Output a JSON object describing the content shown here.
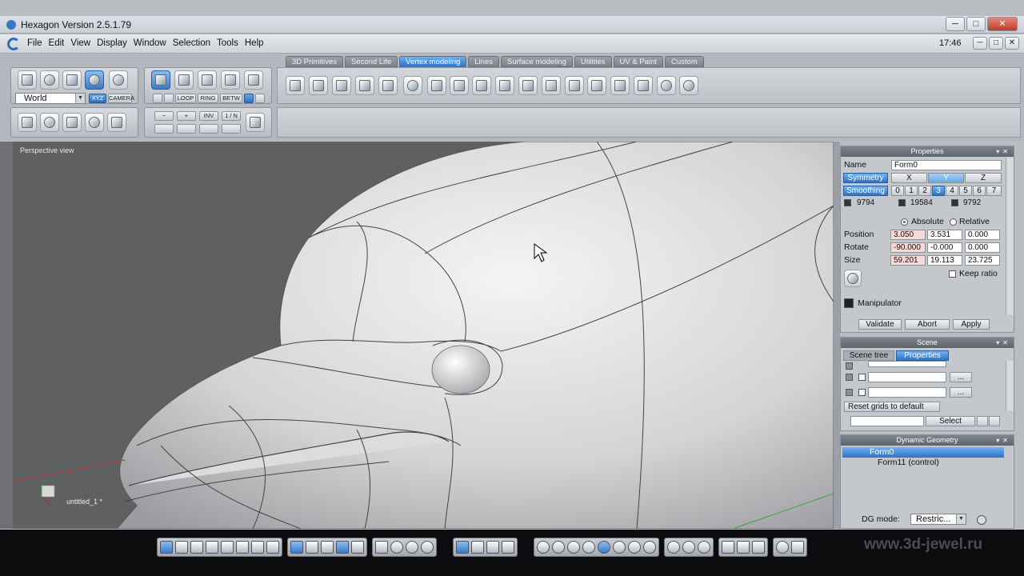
{
  "window": {
    "title": "Hexagon Version 2.5.1.79",
    "minimize": "─",
    "maximize": "□",
    "close": "✕"
  },
  "menubar": {
    "items": [
      "File",
      "Edit",
      "View",
      "Display",
      "Window",
      "Selection",
      "Tools",
      "Help"
    ],
    "clock": "17:46",
    "minimize": "─",
    "maximize": "□",
    "close": "✕"
  },
  "toolbar": {
    "coord_select": "World",
    "xyz": "XYZ",
    "camera": "CAMERA",
    "loop": "LOOP",
    "ring": "RING",
    "betw": "BETW",
    "minus": "−",
    "plus": "+",
    "inv": "INV",
    "one_n": "1 / N"
  },
  "tabs": [
    "3D Primitives",
    "Second Life",
    "Vertex modeling",
    "Lines",
    "Surface modeling",
    "Utilities",
    "UV & Paint",
    "Custom"
  ],
  "active_tab": "Vertex modeling",
  "viewport": {
    "label": "Perspective view",
    "scene_name": "untitled_1 *"
  },
  "properties": {
    "title": "Properties",
    "name_label": "Name",
    "name_value": "Form0",
    "symmetry_label": "Symmetry",
    "axes": [
      "X",
      "Y",
      "Z"
    ],
    "smoothing_label": "Smoothing",
    "smoothing_levels": [
      "0",
      "1",
      "2",
      "3",
      "4",
      "5",
      "6",
      "7"
    ],
    "counts": [
      "9794",
      "19584",
      "9792"
    ],
    "absolute": "Absolute",
    "relative": "Relative",
    "position_label": "Position",
    "position": [
      "3.050",
      "3.531",
      "0.000"
    ],
    "rotate_label": "Rotate",
    "rotate": [
      "-90.000",
      "-0.000",
      "0.000"
    ],
    "size_label": "Size",
    "size": [
      "59.201",
      "19.113",
      "23.725"
    ],
    "keep_ratio": "Keep ratio",
    "manipulator": "Manipulator",
    "validate": "Validate",
    "abort": "Abort",
    "apply": "Apply"
  },
  "scene": {
    "title": "Scene",
    "tab_tree": "Scene tree",
    "tab_props": "Properties",
    "dots": "...",
    "reset": "Reset grids to default",
    "select": "Select"
  },
  "dynamic_geometry": {
    "title": "Dynamic Geometry",
    "items": [
      "Form0",
      "Form11 (control)"
    ],
    "mode_label": "DG mode:",
    "mode_value": "Restric..."
  },
  "watermark": "www.3d-jewel.ru",
  "colors": {
    "accent": "#2f73c7",
    "viewport_bg": "#5f6062"
  }
}
